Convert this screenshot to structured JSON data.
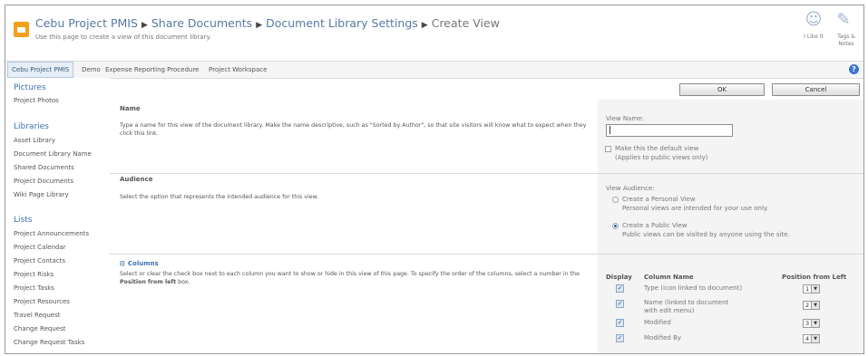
{
  "header": {
    "breadcrumb": [
      "Cebu Project PMIS",
      "Share Documents",
      "Document Library Settings",
      "Create View"
    ],
    "separator": "▶",
    "subtitle": "Use this page to create a view of this document library.",
    "i_like_it": "I Like It",
    "tags_notes": [
      "Tags &",
      "Notes"
    ]
  },
  "nav": {
    "tabs": [
      "Cebu Project PMIS",
      "Demo",
      "Expense Reporting Procedure",
      "Project Workspace"
    ],
    "help": "?"
  },
  "leftnav": {
    "pictures_heading": "Pictures",
    "pictures": [
      "Project Photos"
    ],
    "libraries_heading": "Libraries",
    "libraries": [
      "Asset Library",
      "Document Library Name",
      "Shared Documents",
      "Project Documents",
      "Wiki Page Library"
    ],
    "lists_heading": "Lists",
    "lists": [
      "Project Announcements",
      "Project Calendar",
      "Project Contacts",
      "Project Risks",
      "Project Tasks",
      "Project Resources",
      "Travel Request",
      "Change Request",
      "Change Request Tasks"
    ]
  },
  "buttons": {
    "ok": "OK",
    "cancel": "Cancel"
  },
  "name_section": {
    "title": "Name",
    "desc": "Type a name for this view of the document library. Make the name descriptive, such as \"Sorted by Author\", so that site visitors will know what to expect when they click this link.",
    "view_name_label": "View Name:",
    "view_name_value": "",
    "default_label": "Make this the default view",
    "default_note": "(Applies to public views only)"
  },
  "audience_section": {
    "title": "Audience",
    "desc": "Select the option that represents the intended audience for this view.",
    "label": "View Audience:",
    "personal": "Create a Personal View",
    "personal_note": "Personal views are intended for your use only.",
    "public": "Create a Public View",
    "public_note": "Public views can be visited by anyone using the site."
  },
  "columns_section": {
    "title": "Columns",
    "toggle": "⊟",
    "desc_prefix": "Select or clear the check box next to each column you want to show or hide in this view of this page. To specify the order of the columns, select a number in the",
    "desc_bold": "Position from left",
    "desc_suffix": "box.",
    "headers": {
      "display": "Display",
      "name": "Column Name",
      "position": "Position from Left"
    },
    "rows": [
      {
        "name": "Type (icon linked to document)",
        "position": "1",
        "checked": true
      },
      {
        "name": "Name (linked to document with edit menu)",
        "position": "2",
        "checked": true
      },
      {
        "name": "Modified",
        "position": "3",
        "checked": true
      },
      {
        "name": "Modified By",
        "position": "4",
        "checked": true
      }
    ]
  },
  "colors": {
    "accent": "#3b73af",
    "logo": "#f0a21b",
    "panel": "#f4f4f4"
  }
}
